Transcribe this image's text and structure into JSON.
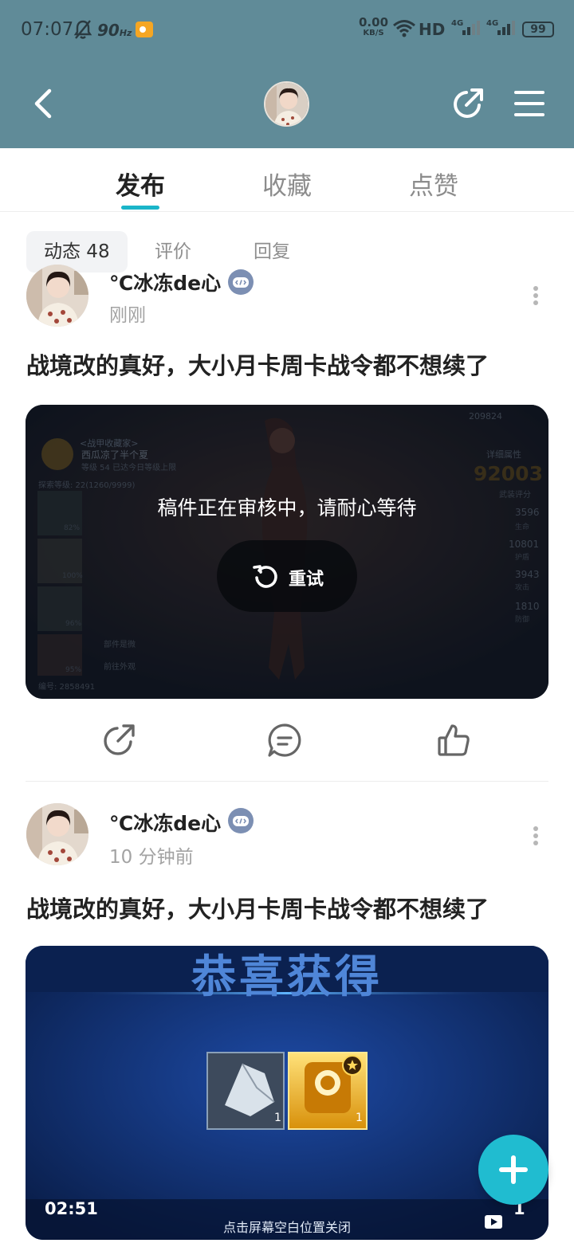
{
  "status_bar": {
    "time": "07:07",
    "refresh": "90",
    "refresh_unit": "Hz",
    "speed_value": "0.00",
    "speed_unit": "KB/S",
    "network": "HD",
    "signal1": "4G",
    "signal2": "4G",
    "battery": "99"
  },
  "header": {
    "back_icon": "chevron-left-icon",
    "share_icon": "share-icon",
    "menu_icon": "menu-icon"
  },
  "tabs": [
    {
      "label": "发布",
      "active": true
    },
    {
      "label": "收藏",
      "active": false
    },
    {
      "label": "点赞",
      "active": false
    }
  ],
  "subtabs": [
    {
      "label": "动态 48",
      "active": true
    },
    {
      "label": "评价",
      "active": false
    },
    {
      "label": "回复",
      "active": false
    }
  ],
  "posts": [
    {
      "username": "℃冰冻de心",
      "time": "刚刚",
      "text": "战境改的真好，大小月卡周卡战令都不想续了",
      "review_message": "稿件正在审核中，请耐心等待",
      "retry_label": "重试",
      "game": {
        "top_value1": "209824",
        "player_title": "<战甲收藏家>",
        "player_name": "西瓜凉了半个夏",
        "player_sub": "等级 54 已达今日等级上限",
        "explore": "探索等级: 22(1260/9999)",
        "power_label": "详细属性",
        "power": "92003",
        "power_sub": "武装评分",
        "stats": [
          "3596",
          "10801",
          "3943",
          "1810"
        ],
        "stat_labels": [
          "生命",
          "护盾",
          "攻击",
          "防御"
        ],
        "percents": [
          "82%",
          "100%",
          "96%",
          "95%"
        ],
        "btn1": "部件是微",
        "btn2": "前往外观",
        "id": "编号: 2858491"
      }
    },
    {
      "username": "℃冰冻de心",
      "time": "10 分钟前",
      "text": "战境改的真好，大小月卡周卡战令都不想续了",
      "video": {
        "banner": "恭喜获得",
        "duration": "02:51",
        "count": "1",
        "close_hint": "点击屏幕空白位置关闭",
        "item_counts": [
          "1",
          "1"
        ]
      }
    }
  ],
  "fab_icon": "plus-icon"
}
